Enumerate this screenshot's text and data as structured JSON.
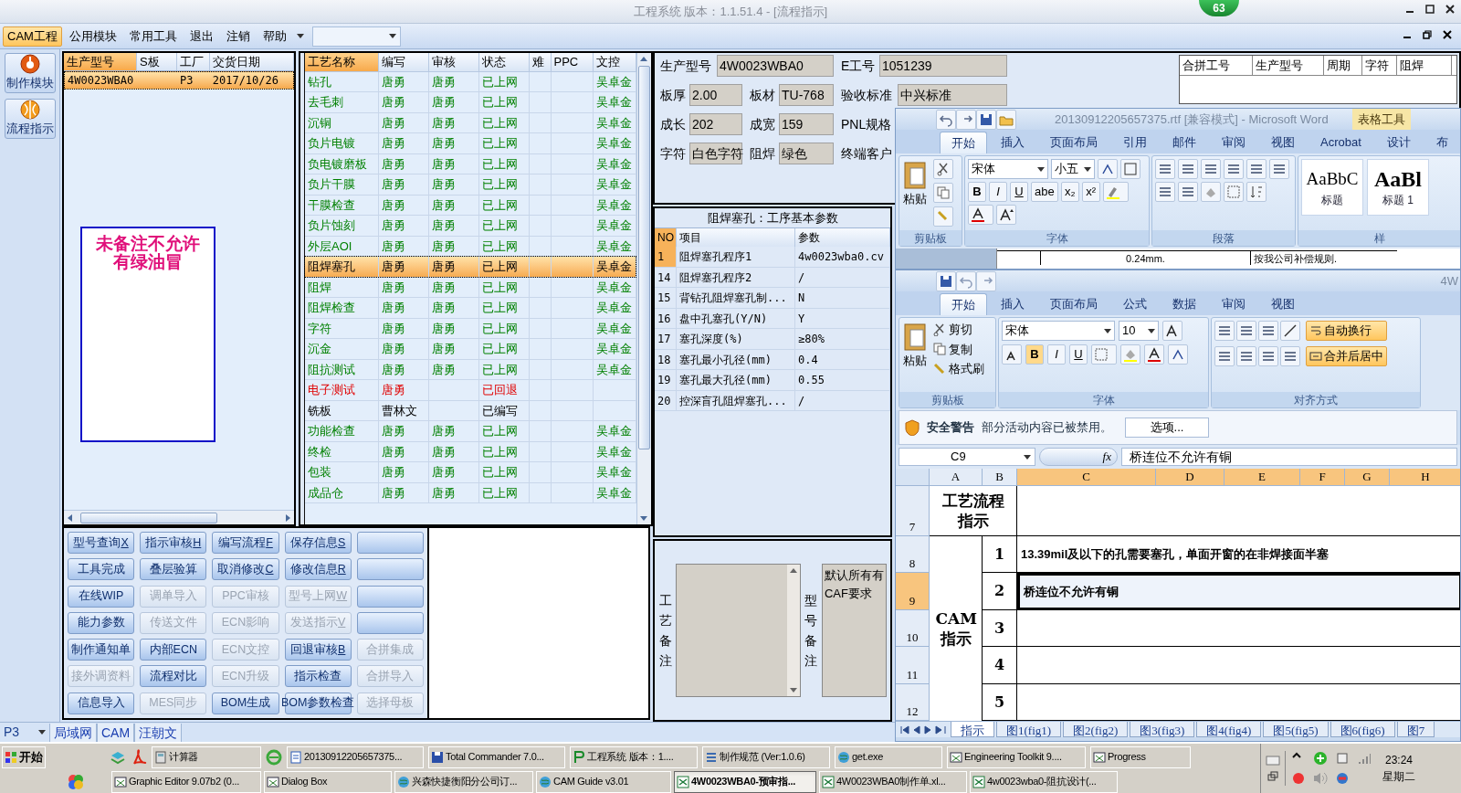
{
  "title_bar": {
    "title": "工程系统  版本：1.1.51.4 - [流程指示]",
    "badge": "63"
  },
  "menu": {
    "items": [
      {
        "label": "CAM工程",
        "selected": true
      },
      {
        "label": "公用模块",
        "selected": false
      },
      {
        "label": "常用工具",
        "selected": false
      },
      {
        "label": "退出",
        "selected": false
      },
      {
        "label": "注销",
        "selected": false
      },
      {
        "label": "帮助",
        "selected": false
      }
    ]
  },
  "sidebar": {
    "items": [
      {
        "label": "制作模块",
        "kind": "bomb"
      },
      {
        "label": "流程指示",
        "kind": "ball"
      }
    ]
  },
  "product_table": {
    "columns": [
      {
        "label": "生产型号",
        "sorted": true
      },
      {
        "label": "S板",
        "sorted": false
      },
      {
        "label": "工厂",
        "sorted": false
      },
      {
        "label": "交货日期",
        "sorted": false
      }
    ],
    "rows": [
      {
        "model": "4W0023WBA0",
        "factory": "P3",
        "date": "2017/10/26",
        "selected": true
      }
    ],
    "note": "未备注不允许有绿油冒"
  },
  "process_table": {
    "columns": [
      {
        "label": "工艺名称",
        "sorted": true
      },
      {
        "label": "编写",
        "sorted": false
      },
      {
        "label": "审核",
        "sorted": false
      },
      {
        "label": "状态",
        "sorted": false
      },
      {
        "label": "难",
        "sorted": false
      },
      {
        "label": "PPC",
        "sorted": false
      },
      {
        "label": "文控",
        "sorted": false
      }
    ],
    "rows": [
      {
        "name": "钻孔",
        "writer": "唐勇",
        "reviewer": "唐勇",
        "status": "已上网",
        "control": "吴卓金",
        "kind": "online",
        "selected": false
      },
      {
        "name": "去毛刺",
        "writer": "唐勇",
        "reviewer": "唐勇",
        "status": "已上网",
        "control": "吴卓金",
        "kind": "online",
        "selected": false
      },
      {
        "name": "沉铜",
        "writer": "唐勇",
        "reviewer": "唐勇",
        "status": "已上网",
        "control": "吴卓金",
        "kind": "online",
        "selected": false
      },
      {
        "name": "负片电镀",
        "writer": "唐勇",
        "reviewer": "唐勇",
        "status": "已上网",
        "control": "吴卓金",
        "kind": "online",
        "selected": false
      },
      {
        "name": "负电镀磨板",
        "writer": "唐勇",
        "reviewer": "唐勇",
        "status": "已上网",
        "control": "吴卓金",
        "kind": "online",
        "selected": false
      },
      {
        "name": "负片干膜",
        "writer": "唐勇",
        "reviewer": "唐勇",
        "status": "已上网",
        "control": "吴卓金",
        "kind": "online",
        "selected": false
      },
      {
        "name": "干膜检查",
        "writer": "唐勇",
        "reviewer": "唐勇",
        "status": "已上网",
        "control": "吴卓金",
        "kind": "online",
        "selected": false
      },
      {
        "name": "负片蚀刻",
        "writer": "唐勇",
        "reviewer": "唐勇",
        "status": "已上网",
        "control": "吴卓金",
        "kind": "online",
        "selected": false
      },
      {
        "name": "外层AOI",
        "writer": "唐勇",
        "reviewer": "唐勇",
        "status": "已上网",
        "control": "吴卓金",
        "kind": "online",
        "selected": false
      },
      {
        "name": "阻焊塞孔",
        "writer": "唐勇",
        "reviewer": "唐勇",
        "status": "已上网",
        "control": "吴卓金",
        "kind": "online",
        "selected": true
      },
      {
        "name": "阻焊",
        "writer": "唐勇",
        "reviewer": "唐勇",
        "status": "已上网",
        "control": "吴卓金",
        "kind": "online",
        "selected": false
      },
      {
        "name": "阻焊检查",
        "writer": "唐勇",
        "reviewer": "唐勇",
        "status": "已上网",
        "control": "吴卓金",
        "kind": "online",
        "selected": false
      },
      {
        "name": "字符",
        "writer": "唐勇",
        "reviewer": "唐勇",
        "status": "已上网",
        "control": "吴卓金",
        "kind": "online",
        "selected": false
      },
      {
        "name": "沉金",
        "writer": "唐勇",
        "reviewer": "唐勇",
        "status": "已上网",
        "control": "吴卓金",
        "kind": "online",
        "selected": false
      },
      {
        "name": "阻抗测试",
        "writer": "唐勇",
        "reviewer": "唐勇",
        "status": "已上网",
        "control": "吴卓金",
        "kind": "online",
        "selected": false
      },
      {
        "name": "电子测试",
        "writer": "唐勇",
        "status": "已回退",
        "kind": "returned",
        "selected": false
      },
      {
        "name": "铣板",
        "writer": "曹林文",
        "status": "已编写",
        "kind": "written",
        "selected": false
      },
      {
        "name": "功能检查",
        "writer": "唐勇",
        "reviewer": "唐勇",
        "status": "已上网",
        "control": "吴卓金",
        "kind": "online",
        "selected": false
      },
      {
        "name": "终检",
        "writer": "唐勇",
        "reviewer": "唐勇",
        "status": "已上网",
        "control": "吴卓金",
        "kind": "online",
        "selected": false
      },
      {
        "name": "包装",
        "writer": "唐勇",
        "reviewer": "唐勇",
        "status": "已上网",
        "control": "吴卓金",
        "kind": "online",
        "selected": false
      },
      {
        "name": "成品仓",
        "writer": "唐勇",
        "reviewer": "唐勇",
        "status": "已上网",
        "control": "吴卓金",
        "kind": "online",
        "selected": false
      }
    ]
  },
  "buttons": [
    {
      "label": "型号查询",
      "hotkey": "X",
      "disabled": false
    },
    {
      "label": "指示审核",
      "hotkey": "H",
      "disabled": false
    },
    {
      "label": "编写流程",
      "hotkey": "F",
      "disabled": false
    },
    {
      "label": "保存信息",
      "hotkey": "S",
      "disabled": false
    },
    {
      "disabled": false
    },
    {
      "label": "工具完成",
      "disabled": false
    },
    {
      "label": "叠层验算",
      "disabled": false
    },
    {
      "label": "取消修改",
      "hotkey": "C",
      "disabled": false
    },
    {
      "label": "修改信息",
      "hotkey": "R",
      "disabled": false
    },
    {
      "disabled": false
    },
    {
      "label": "在线WIP",
      "disabled": false
    },
    {
      "label": "调单导入",
      "disabled": true
    },
    {
      "label": "PPC审核",
      "disabled": true
    },
    {
      "label": "型号上网",
      "hotkey": "W",
      "disabled": true
    },
    {
      "disabled": false
    },
    {
      "label": "能力参数",
      "disabled": false
    },
    {
      "label": "传送文件",
      "disabled": true
    },
    {
      "label": "ECN影响",
      "disabled": true
    },
    {
      "label": "发送指示",
      "hotkey": "V",
      "disabled": true
    },
    {
      "disabled": false
    },
    {
      "label": "制作通知单",
      "disabled": false
    },
    {
      "label": "内部ECN",
      "disabled": false
    },
    {
      "label": "ECN文控",
      "disabled": true
    },
    {
      "label": "回退审核",
      "hotkey": "B",
      "disabled": false
    },
    {
      "label": "合拼集成",
      "disabled": true
    },
    {
      "label": "接外调资料",
      "disabled": true
    },
    {
      "label": "流程对比",
      "disabled": false
    },
    {
      "label": "ECN升级",
      "disabled": true
    },
    {
      "label": "指示检查",
      "disabled": false
    },
    {
      "label": "合拼导入",
      "disabled": true
    },
    {
      "label": "信息导入",
      "disabled": false
    },
    {
      "label": "MES同步",
      "disabled": true
    },
    {
      "label": "BOM生成",
      "disabled": false
    },
    {
      "label": "BOM参数检查",
      "disabled": false
    },
    {
      "label": "选择母板",
      "disabled": true
    }
  ],
  "info": {
    "fields": [
      {
        "label": "生产型号",
        "value": "4W0023WBA0"
      },
      {
        "label": "E工号",
        "value": "1051239"
      },
      {
        "label": "板厚",
        "value": "2.00"
      },
      {
        "label": "板材",
        "value": "TU-768"
      },
      {
        "label": "验收标准",
        "value": "中兴标准"
      },
      {
        "label": "成长",
        "value": "202"
      },
      {
        "label": "成宽",
        "value": "159"
      },
      {
        "label": "PNL规格"
      },
      {
        "label": "字符",
        "value": "白色字符"
      },
      {
        "label": "阻焊",
        "value": "绿色"
      },
      {
        "label": "终端客户"
      }
    ]
  },
  "merge_table": {
    "columns": [
      "合拼工号",
      "生产型号",
      "周期",
      "字符",
      "阻焊"
    ]
  },
  "params": {
    "title": "阻焊塞孔：工序基本参数",
    "columns": [
      "NO",
      "项目",
      "参数"
    ],
    "rows": [
      {
        "no": "1",
        "item": "阻焊塞孔程序1",
        "value": "4w0023wba0.cv",
        "selected": true
      },
      {
        "no": "14",
        "item": "阻焊塞孔程序2",
        "value": "/",
        "selected": false
      },
      {
        "no": "15",
        "item": "背钻孔阻焊塞孔制...",
        "value": "N",
        "selected": false
      },
      {
        "no": "16",
        "item": "盘中孔塞孔(Y/N)",
        "value": "Y",
        "selected": false
      },
      {
        "no": "17",
        "item": "塞孔深度(%)",
        "value": "≥80%",
        "selected": false
      },
      {
        "no": "18",
        "item": "塞孔最小孔径(mm)",
        "value": "0.4",
        "selected": false
      },
      {
        "no": "19",
        "item": "塞孔最大孔径(mm)",
        "value": "0.55",
        "selected": false
      },
      {
        "no": "20",
        "item": "控深盲孔阻焊塞孔...",
        "value": "/",
        "selected": false
      }
    ]
  },
  "remarks": {
    "process_label": "工艺备注",
    "model_label": "型号备注",
    "model_text": [
      "默认所有有",
      "CAF要求"
    ]
  },
  "word": {
    "title": "20130912205657375.rtf [兼容模式] - Microsoft Word",
    "context_tab": "表格工具",
    "tabs": [
      {
        "label": "开始",
        "selected": true
      },
      {
        "label": "插入",
        "selected": false
      },
      {
        "label": "页面布局",
        "selected": false
      },
      {
        "label": "引用",
        "selected": false
      },
      {
        "label": "邮件",
        "selected": false
      },
      {
        "label": "审阅",
        "selected": false
      },
      {
        "label": "视图",
        "selected": false
      },
      {
        "label": "Acrobat",
        "selected": false
      },
      {
        "label": "设计",
        "selected": false
      },
      {
        "label": "布",
        "selected": false
      }
    ],
    "paste": "粘贴",
    "clipboard_group": "剪贴板",
    "font_name": "宋体",
    "font_size": "小五",
    "font_buttons": [
      "B",
      "I",
      "U",
      "abe",
      "x₂",
      "x²"
    ],
    "font_group": "字体",
    "paragraph_group": "段落",
    "styles": [
      {
        "sample": "AaBbC",
        "name": "标题"
      },
      {
        "sample": "AaBl",
        "name": "标题 1"
      }
    ],
    "styles_group": "样",
    "doc_texts": [
      "0.24mm.",
      "按我公司补偿规则."
    ]
  },
  "excel": {
    "title": "4W",
    "tabs": [
      {
        "label": "开始",
        "selected": true
      },
      {
        "label": "插入",
        "selected": false
      },
      {
        "label": "页面布局",
        "selected": false
      },
      {
        "label": "公式",
        "selected": false
      },
      {
        "label": "数据",
        "selected": false
      },
      {
        "label": "审阅",
        "selected": false
      },
      {
        "label": "视图",
        "selected": false
      }
    ],
    "paste": "粘贴",
    "cut": "剪切",
    "copy": "复制",
    "painter": "格式刷",
    "clipboard_group": "剪贴板",
    "font_name": "宋体",
    "font_size": "10",
    "font_buttons": [
      "B",
      "I",
      "U"
    ],
    "font_group": "字体",
    "wrap": "自动换行",
    "merge": "合并后居中",
    "align_group": "对齐方式",
    "warning": {
      "title": "安全警告",
      "text": "部分活动内容已被禁用。",
      "button": "选项..."
    },
    "name_box": "C9",
    "fx": "fx",
    "formula": "桥连位不允许有铜",
    "columns": [
      {
        "label": "A",
        "selected": false
      },
      {
        "label": "B",
        "selected": false
      },
      {
        "label": "C",
        "selected": true
      },
      {
        "label": "D",
        "selected": true
      },
      {
        "label": "E",
        "selected": true
      },
      {
        "label": "F",
        "selected": true
      },
      {
        "label": "G",
        "selected": true
      },
      {
        "label": "H",
        "selected": true
      }
    ],
    "row_headers": [
      {
        "label": "7",
        "selected": false
      },
      {
        "label": "8",
        "selected": false
      },
      {
        "label": "9",
        "selected": true
      },
      {
        "label": "10",
        "selected": false
      },
      {
        "label": "11",
        "selected": false
      },
      {
        "label": "12",
        "selected": false
      }
    ],
    "header_cell": "工艺流程指示",
    "cam_cell": "CAM指示",
    "items": [
      {
        "no": "1",
        "text": "13.39mil及以下的孔需要塞孔，单面开窗的在非焊接面半塞",
        "selected": false
      },
      {
        "no": "2",
        "text": "桥连位不允许有铜",
        "selected": true
      },
      {
        "no": "3",
        "selected": false
      },
      {
        "no": "4",
        "selected": false
      },
      {
        "no": "5",
        "selected": false
      }
    ],
    "sheets": [
      {
        "label": "指示",
        "selected": true
      },
      {
        "label": "图1(fig1)",
        "selected": false
      },
      {
        "label": "图2(fig2)",
        "selected": false
      },
      {
        "label": "图3(fig3)",
        "selected": false
      },
      {
        "label": "图4(fig4)",
        "selected": false
      },
      {
        "label": "图5(fig5)",
        "selected": false
      },
      {
        "label": "图6(fig6)",
        "selected": false
      },
      {
        "label": "图7",
        "selected": false
      }
    ]
  },
  "status_bar": {
    "factory": "P3",
    "tabs": [
      "局域网",
      "CAM",
      "汪朝文"
    ]
  },
  "taskbar": {
    "start": "开始",
    "row1": [
      {
        "label": "计算器",
        "kind": "calc",
        "selected": false
      },
      {
        "label": "20130912205657375...",
        "kind": "word",
        "selected": false
      },
      {
        "label": "Total Commander 7.0...",
        "kind": "disk",
        "selected": false
      },
      {
        "label": "工程系统  版本：1....",
        "kind": "app",
        "selected": false
      },
      {
        "label": "制作规范 (Ver:1.0.6)",
        "kind": "doc",
        "selected": false
      },
      {
        "label": "get.exe",
        "kind": "globe",
        "selected": false
      },
      {
        "label": "Engineering Toolkit 9....",
        "kind": "win",
        "selected": false
      },
      {
        "label": "Progress",
        "kind": "win",
        "selected": false
      }
    ],
    "row2": [
      {
        "label": "Graphic Editor 9.07b2 (0...",
        "kind": "win",
        "selected": false
      },
      {
        "label": "Dialog Box",
        "kind": "win",
        "selected": false
      },
      {
        "label": "兴森快捷衡阳分公司订...",
        "kind": "globe",
        "selected": false
      },
      {
        "label": "CAM Guide v3.01",
        "kind": "globe",
        "selected": false
      },
      {
        "label": "4W0023WBA0-预审指...",
        "kind": "excel",
        "selected": true
      },
      {
        "label": "4W0023WBA0制作单.xl...",
        "kind": "excel",
        "selected": false
      },
      {
        "label": "4w0023wba0-阻抗设计(...",
        "kind": "excel",
        "selected": false
      }
    ],
    "clock": "23:24",
    "day": "星期二"
  }
}
